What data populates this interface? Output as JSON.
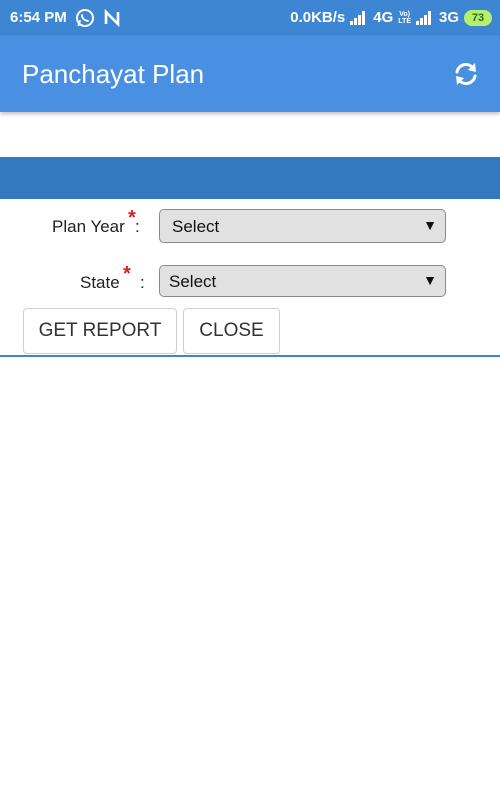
{
  "status_bar": {
    "time": "6:54 PM",
    "network_speed": "0.0KB/s",
    "net1": "4G",
    "volte_line1": "Vo)",
    "volte_line2": "LTE",
    "net2": "3G",
    "battery": "73",
    "icons": [
      "whatsapp-icon",
      "n-notification-icon",
      "signal-icon",
      "signal-icon-2",
      "battery-icon"
    ]
  },
  "app_bar": {
    "title": "Panchayat Plan",
    "refresh_icon": "refresh-icon"
  },
  "form": {
    "plan_year": {
      "label": "Plan Year",
      "required_mark": "*",
      "colon": ":",
      "selected": "Select"
    },
    "state": {
      "label": "State",
      "required_mark": "*",
      "colon": ":",
      "selected": "Select"
    },
    "dropdown_arrow": "▼"
  },
  "buttons": {
    "get_report": "GET REPORT",
    "close": "CLOSE"
  },
  "colors": {
    "status_bar": "#3d86d4",
    "app_bar": "#4a90e2",
    "band": "#3478c0",
    "required": "#e01e1e"
  }
}
